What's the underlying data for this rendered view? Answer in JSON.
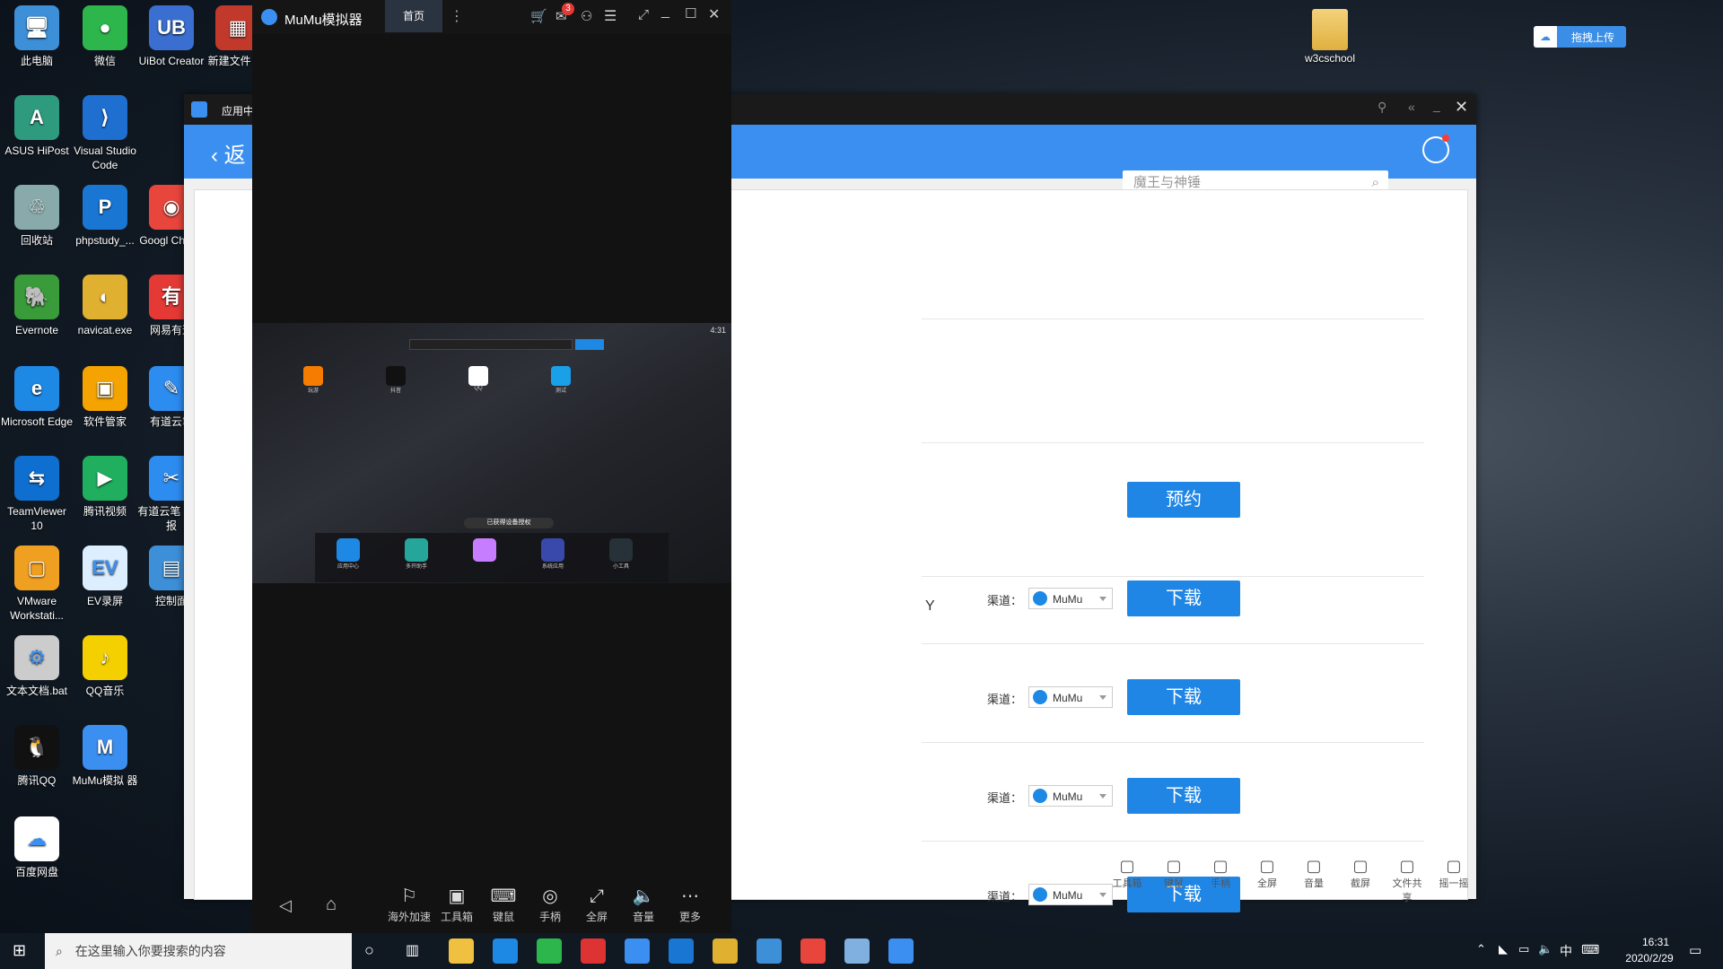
{
  "desktop": {
    "icons": [
      {
        "label": "此电脑",
        "color": "#3d8fd8",
        "glyph": "🖥"
      },
      {
        "label": "微信",
        "color": "#2db64b",
        "glyph": "●"
      },
      {
        "label": "UiBot Creator",
        "color": "#3a6fd1",
        "glyph": "UB"
      },
      {
        "label": "新建文件 zip",
        "color": "#c0392b",
        "glyph": "▦"
      },
      {
        "label": "ASUS HiPost",
        "color": "#2e9b7f",
        "glyph": "A"
      },
      {
        "label": "Visual Studio Code",
        "color": "#1e6fd0",
        "glyph": "⟩"
      },
      {
        "label": "回收站",
        "color": "#8aa",
        "glyph": "♲"
      },
      {
        "label": "phpstudy_...",
        "color": "#1976d2",
        "glyph": "P"
      },
      {
        "label": "Googl Chrom",
        "color": "#e8453c",
        "glyph": "◉"
      },
      {
        "label": "Evernote",
        "color": "#3a9b3a",
        "glyph": "🐘"
      },
      {
        "label": "navicat.exe",
        "color": "#e0b030",
        "glyph": "◐"
      },
      {
        "label": "网易有道",
        "color": "#e53935",
        "glyph": "有"
      },
      {
        "label": "Microsoft Edge",
        "color": "#1e88e5",
        "glyph": "e"
      },
      {
        "label": "软件管家",
        "color": "#f4a300",
        "glyph": "▣"
      },
      {
        "label": "有道云笔",
        "color": "#2d8cf0",
        "glyph": "✎"
      },
      {
        "label": "TeamViewer 10",
        "color": "#0e6fd1",
        "glyph": "⇆"
      },
      {
        "label": "腾讯视频",
        "color": "#1faf5e",
        "glyph": "▶"
      },
      {
        "label": "有道云笔 页剪报",
        "color": "#2d8cf0",
        "glyph": "✂"
      },
      {
        "label": "VMware Workstati...",
        "color": "#f0a020",
        "glyph": "▢"
      },
      {
        "label": "EV录屏",
        "color": "#ddeeff",
        "glyph": "EV"
      },
      {
        "label": "控制面",
        "color": "#3d8fd8",
        "glyph": "▤"
      },
      {
        "label": "文本文档.bat",
        "color": "#ccc",
        "glyph": "⚙"
      },
      {
        "label": "QQ音乐",
        "color": "#f5d000",
        "glyph": "♪"
      },
      {
        "label": "腾讯QQ",
        "color": "#111",
        "glyph": "🐧"
      },
      {
        "label": "MuMu模拟 器",
        "color": "#3b8ff0",
        "glyph": "M"
      },
      {
        "label": "百度网盘",
        "color": "#ffffff",
        "glyph": "☁"
      }
    ],
    "folder_label": "w3cschool",
    "baidu_upload_label": "拖拽上传"
  },
  "app_center": {
    "title": "应用中",
    "back_label": "返",
    "search_placeholder": "魔王与神锤",
    "reserve_label": "预约",
    "partial_text": "Y",
    "rows": [
      {
        "channel_label": "渠道：",
        "channel": "MuMu",
        "button": "下载"
      },
      {
        "channel_label": "渠道：",
        "channel": "MuMu",
        "button": "下载"
      },
      {
        "channel_label": "渠道：",
        "channel": "MuMu",
        "button": "下载"
      },
      {
        "channel_label": "渠道：",
        "channel": "MuMu",
        "button": "下载"
      }
    ],
    "faded_toolbar": [
      "工具箱",
      "键鼠",
      "手柄",
      "全屏",
      "音量",
      "截屏",
      "文件共享",
      "摇一摇"
    ]
  },
  "mumu": {
    "title": "MuMu模拟器",
    "tab_home": "首页",
    "notif_count": "3",
    "android": {
      "time": "4:31",
      "apps": [
        "玩游",
        "抖音",
        "QQ",
        "测试"
      ],
      "dock": [
        "应用中心",
        "多开助手",
        "",
        "系统应用",
        "小工具"
      ],
      "toast": "已获得设备授权"
    },
    "nav": [
      "海外加速",
      "工具箱",
      "键鼠",
      "手柄",
      "全屏",
      "音量",
      "更多"
    ]
  },
  "taskbar": {
    "search_placeholder": "在这里输入你要搜索的内容",
    "time": "16:31",
    "date": "2020/2/29",
    "ime": "中"
  }
}
